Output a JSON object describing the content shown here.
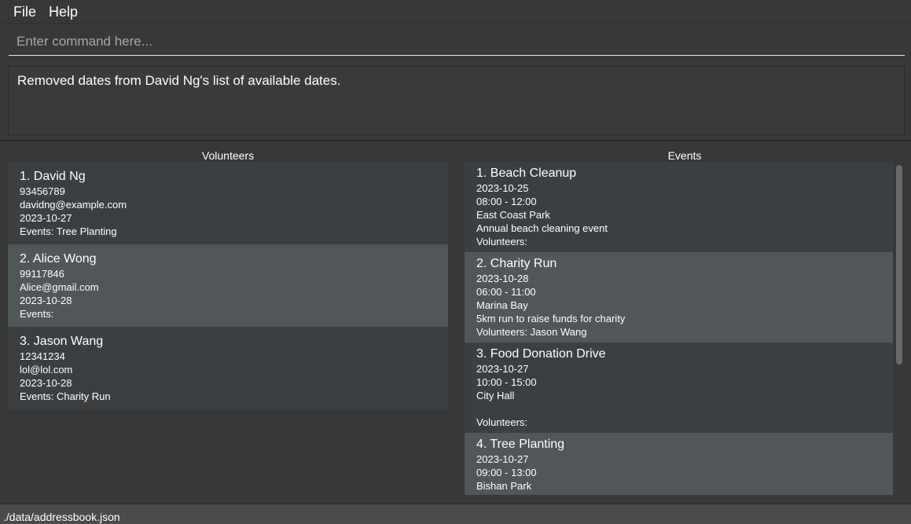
{
  "menu": {
    "file": "File",
    "help": "Help"
  },
  "command": {
    "placeholder": "Enter command here...",
    "value": ""
  },
  "result": {
    "text": "Removed dates from David Ng's list of available dates."
  },
  "volunteers": {
    "title": "Volunteers",
    "items": [
      {
        "title": "1. David Ng",
        "phone": "93456789",
        "email": "davidng@example.com",
        "date": "2023-10-27",
        "events": "Events: Tree Planting"
      },
      {
        "title": "2. Alice Wong",
        "phone": "99117846",
        "email": "Alice@gmail.com",
        "date": "2023-10-28",
        "events": "Events:"
      },
      {
        "title": "3. Jason Wang",
        "phone": "12341234",
        "email": "lol@lol.com",
        "date": "2023-10-28",
        "events": "Events: Charity Run"
      }
    ]
  },
  "events": {
    "title": "Events",
    "items": [
      {
        "title": "1. Beach Cleanup",
        "date": "2023-10-25",
        "time": "08:00 - 12:00",
        "location": "East Coast Park",
        "description": "Annual beach cleaning event",
        "volunteers": "Volunteers:"
      },
      {
        "title": "2. Charity Run",
        "date": "2023-10-28",
        "time": "06:00 - 11:00",
        "location": "Marina Bay",
        "description": "5km run to raise funds for charity",
        "volunteers": "Volunteers: Jason Wang"
      },
      {
        "title": "3. Food Donation Drive",
        "date": "2023-10-27",
        "time": "10:00 - 15:00",
        "location": "City Hall",
        "description": "",
        "volunteers": "Volunteers:"
      },
      {
        "title": "4. Tree Planting",
        "date": "2023-10-27",
        "time": "09:00 - 13:00",
        "location": "Bishan Park",
        "description": "",
        "volunteers": ""
      }
    ]
  },
  "status": {
    "path": "./data/addressbook.json"
  }
}
